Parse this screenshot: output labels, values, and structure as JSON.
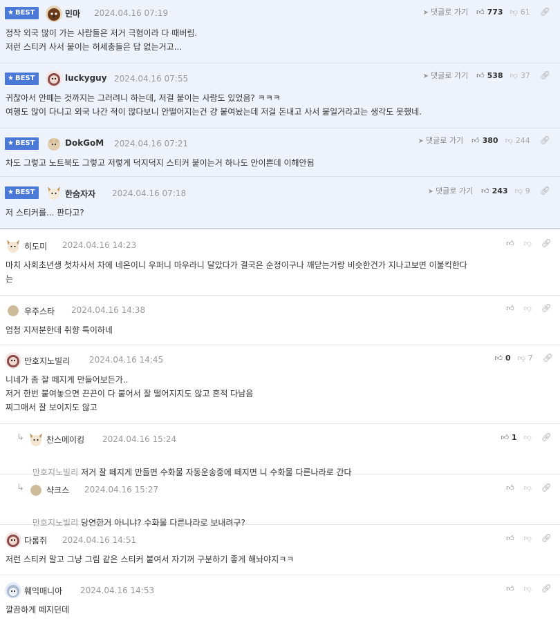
{
  "labels": {
    "best": "BEST",
    "goto": "댓글로 가기"
  },
  "icons": {
    "star": "star-icon",
    "arrow": "send-arrow-icon",
    "up": "thumbs-up-icon",
    "down": "thumbs-down-icon",
    "link": "link-icon",
    "reply": "reply-arrow-icon"
  },
  "best_comments": [
    {
      "nick": "민마",
      "date": "2024.04.16 07:19",
      "up": "773",
      "down": "61",
      "lines": "정작 외국 많이 가는 사람들은 저거 극혐이라 다 때버림.\n저런 스티커 사서 붙이는 허세충들은 답 없는거고..."
    },
    {
      "nick": "luckyguy",
      "date": "2024.04.16 07:55",
      "up": "538",
      "down": "37",
      "lines": "귀찮아서 안떼는 것까지는 그러려니 하는데, 저걸 붙이는 사람도 있었음? ㅋㅋㅋ\n여행도 많이 다니고 외국 나간 적이 많다보니 안떨어지는건 걍 붙여놨는데 저걸 돈내고 사서 붙일거라고는 생각도 못했네."
    },
    {
      "nick": "DokGoM",
      "date": "2024.04.16 07:21",
      "up": "380",
      "down": "244",
      "lines": "차도 그렇고 노트북도 그렇고 저렇게 덕지덕지 스티커 붙이는거 하나도 안이쁜데 이해안됨"
    },
    {
      "nick": "한숨자자",
      "date": "2024.04.16 07:18",
      "up": "243",
      "down": "9",
      "lines": "저 스티커를... 판다고?"
    }
  ],
  "comments": [
    {
      "nick": "히도미",
      "date": "2024.04.16 14:23",
      "up": "",
      "down": "",
      "lines": "마치 사회초년생 첫차사서 차에 네온이니 우퍼니 마우라니 달았다가 결국은 순정이구나 깨닫는거랑 비슷한건가 지나고보면 이불킥한다\n는"
    },
    {
      "nick": "우주스타",
      "date": "2024.04.16 14:38",
      "up": "",
      "down": "",
      "lines": "엄청 지저분한데 취향 특이하네"
    },
    {
      "nick": "만호지노빌리",
      "date": "2024.04.16 14:45",
      "up": "0",
      "down": "7",
      "lines": "니네가 좀 잘 떼지게 만들어보든가..\n저거 한번 붙여놓으면 끈끈이 다 붙어서 잘 떨어지지도 않고 흔적 다남음\n찌그매서 잘 보이지도 않고"
    },
    {
      "nick": "찬스메이킹",
      "date": "2024.04.16 15:24",
      "up": "1",
      "down": "",
      "mention": "만호지노빌리",
      "lines": "저거 잘 떼지게 만들면 수화물 자동운송중에 떼지면 니 수화물 다른나라로 간다"
    },
    {
      "nick": "샥크스",
      "date": "2024.04.16 15:27",
      "up": "",
      "down": "",
      "mention": "만호지노빌리",
      "lines": "당연한거 아니냐? 수화물 다른나라로 보내려구?"
    },
    {
      "nick": "다롬쥐",
      "date": "2024.04.16 14:51",
      "up": "",
      "down": "",
      "lines": "저런 스티커 말고 그냥 그림 같은 스티커 붙여서 자기꺼 구분하기 좋게 해놔야지ㅋㅋ"
    },
    {
      "nick": "훼익매니아",
      "date": "2024.04.16 14:53",
      "up": "",
      "down": "",
      "lines": "깔끔하게 떼지던데"
    }
  ]
}
